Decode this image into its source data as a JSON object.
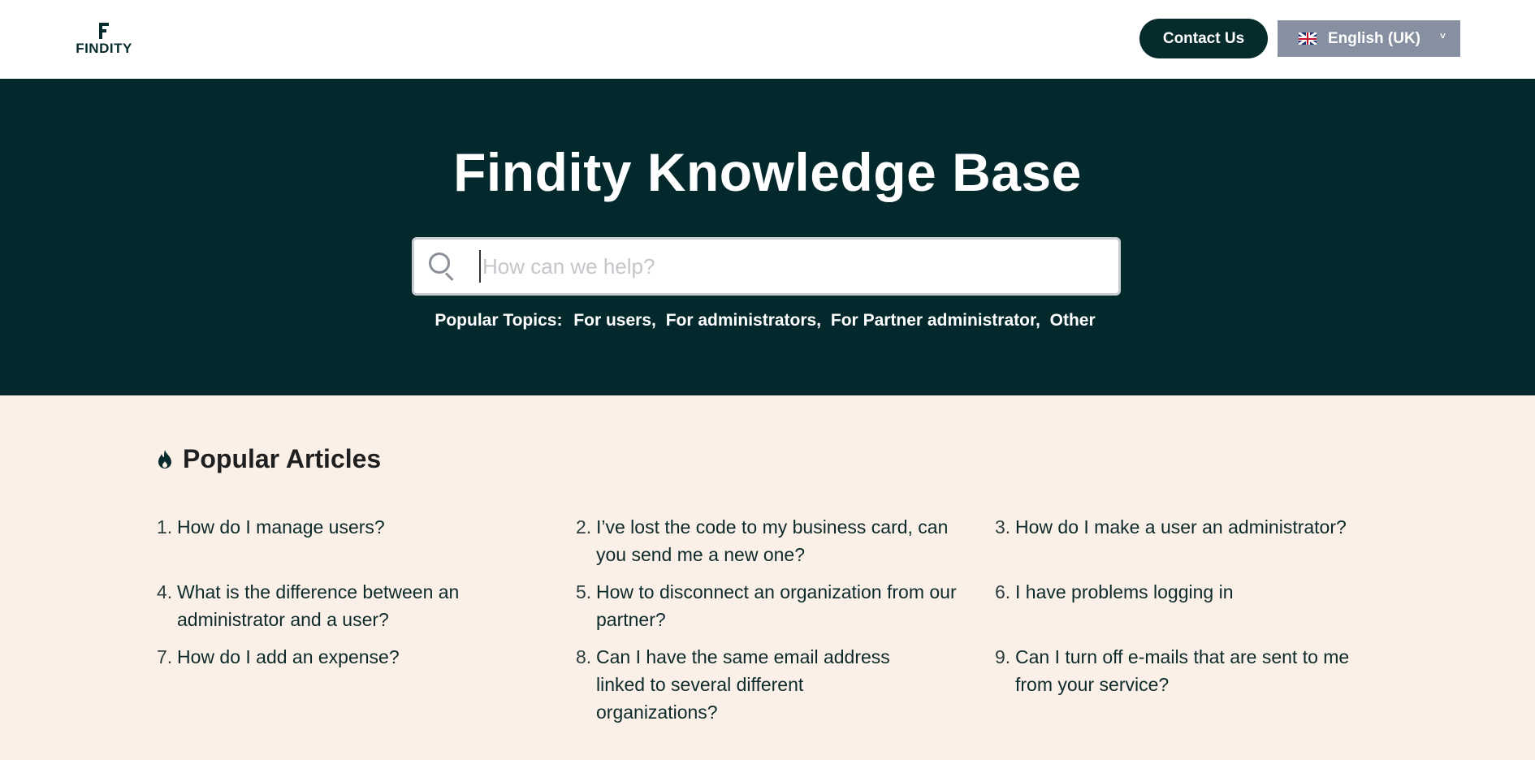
{
  "header": {
    "logo_text": "FINDITY",
    "contact_label": "Contact Us",
    "language_label": "English (UK)",
    "language_caret": "˅"
  },
  "hero": {
    "title": "Findity Knowledge Base",
    "search_placeholder": "How can we help?",
    "topics_label": "Popular Topics:",
    "topics": [
      "For users,",
      "For administrators,",
      "For Partner administrator,",
      "Other"
    ]
  },
  "popular": {
    "title": "Popular Articles",
    "items": [
      {
        "num": "1.",
        "text": "How do I manage users?"
      },
      {
        "num": "2.",
        "text": "I’ve lost the code to my business card, can you send me a new one?"
      },
      {
        "num": "3.",
        "text": "How do I make a user an administrator?"
      },
      {
        "num": "4.",
        "text": "What is the difference between an administrator and a user?"
      },
      {
        "num": "5.",
        "text": "How to disconnect an organization from our partner?"
      },
      {
        "num": "6.",
        "text": "I have problems logging in"
      },
      {
        "num": "7.",
        "text": "How do I add an expense?"
      },
      {
        "num": "8.",
        "text": "Can I have the same email address linked to several different organizations?"
      },
      {
        "num": "9.",
        "text": "Can I turn off e-mails that are sent to me from your service?"
      }
    ]
  },
  "colors": {
    "brand_dark": "#03292d",
    "page_bg": "#faf0e8",
    "lang_bg": "#8790a0"
  }
}
